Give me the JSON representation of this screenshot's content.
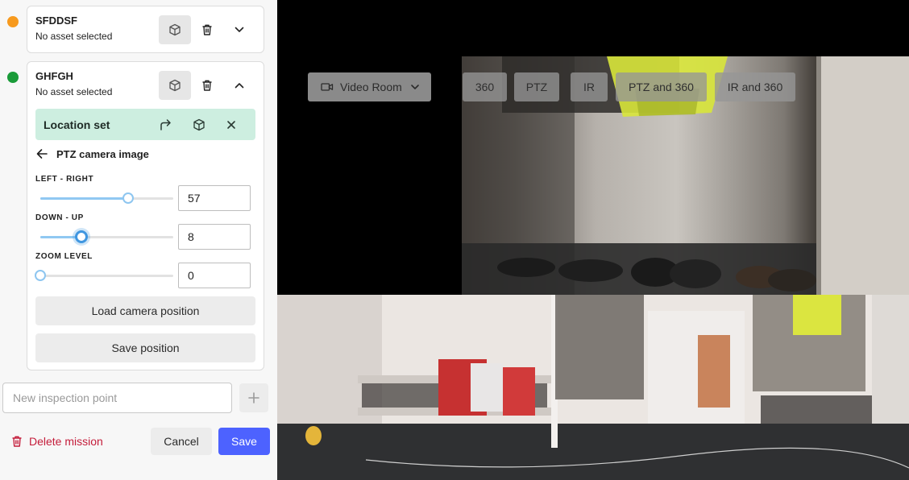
{
  "inspection_points": [
    {
      "title": "SFDDSF",
      "subtitle": "No asset selected",
      "status_color": "#f79a1e",
      "expanded": false
    },
    {
      "title": "GHFGH",
      "subtitle": "No asset selected",
      "status_color": "#1a9b39",
      "expanded": true
    }
  ],
  "location": {
    "label": "Location set"
  },
  "camera_image": {
    "back_title": "PTZ camera image"
  },
  "sliders": [
    {
      "label": "LEFT - RIGHT",
      "value": "57",
      "fraction": 0.66
    },
    {
      "label": "DOWN - UP",
      "value": "8",
      "fraction": 0.31
    },
    {
      "label": "ZOOM LEVEL",
      "value": "0",
      "fraction": 0.0
    }
  ],
  "buttons": {
    "load_position": "Load camera position",
    "save_position": "Save position",
    "delete_mission": "Delete mission",
    "cancel": "Cancel",
    "save": "Save"
  },
  "new_point": {
    "placeholder": "New inspection point"
  },
  "video": {
    "room_select": "Video Room",
    "modes": [
      "360",
      "PTZ",
      "IR",
      "PTZ and 360",
      "IR and 360"
    ]
  },
  "colors": {
    "accent": "#4d62ff",
    "danger": "#c41c3a",
    "location_bg": "#cdeee0"
  }
}
